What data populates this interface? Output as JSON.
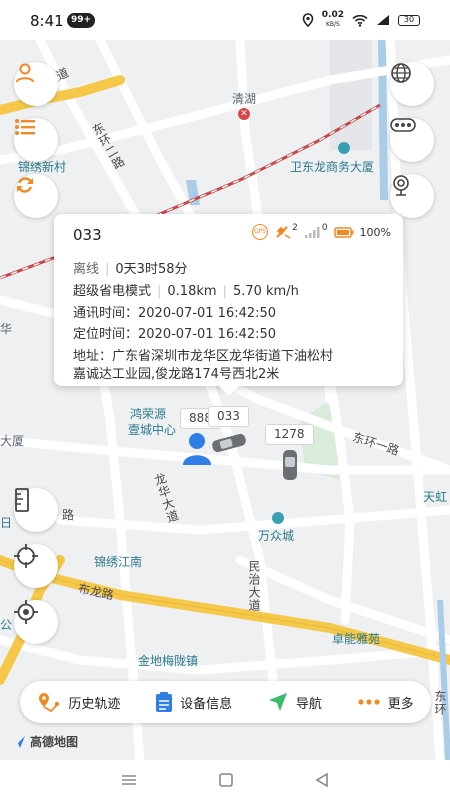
{
  "status_bar": {
    "time": "8:41",
    "notification_badge": "99+",
    "net_speed": "0.02",
    "net_unit": "KB/S",
    "battery": "30"
  },
  "map": {
    "labels": {
      "longhua_avenue_top": "龙华大道",
      "dongjiang_road": "东环二路",
      "qinghu": "清湖",
      "jinxiu_xincun": "锦绣新村",
      "weidonglong": "卫东龙商务大厦",
      "dasha": "大厦",
      "ri": "日",
      "hongrongyuan": "鸿荣源",
      "yicheng_center": "壹城中心",
      "longhua_avenue": "龙华大道",
      "road_suffix": "路",
      "donghuan_1": "东环一路",
      "tianhong": "天虹",
      "wanzhongcheng": "万众城",
      "jinxiu_jiangnan": "锦绣江南",
      "minzhi_avenue": "民治大道",
      "bulong_road": "布龙路",
      "zhuoneng_yayuan": "卓能雅苑",
      "jindi_meilong": "金地梅陇镇",
      "gong": "公",
      "hua": "华",
      "donghuan_left": "东环"
    },
    "plates": {
      "plate_a": "888",
      "plate_b": "033",
      "plate_c": "1278"
    }
  },
  "popup": {
    "title": "033",
    "gps_label": "GPS",
    "satellites": "2",
    "signal": "0",
    "battery_pct": "100%",
    "status": "离线",
    "duration": "0天3时58分",
    "mode": "超级省电模式",
    "distance": "0.18km",
    "speed": "5.70 km/h",
    "comm_time": "通讯时间：2020-07-01 16:42:50",
    "loc_time": "定位时间：2020-07-01 16:42:50",
    "address": "地址：广东省深圳市龙华区龙华街道下油松村",
    "address_line2": "嘉诚达工业园,俊龙路174号西北2米"
  },
  "toolbar": {
    "history": "历史轨迹",
    "device_info": "设备信息",
    "navigation": "导航",
    "more": "更多"
  },
  "amap": "高德地图",
  "colors": {
    "accent_orange": "#f08a24",
    "road_yellow": "#f5c84a",
    "rail_red": "#c7484a",
    "water": "#a9cde8",
    "person_blue": "#2e7ee6"
  }
}
